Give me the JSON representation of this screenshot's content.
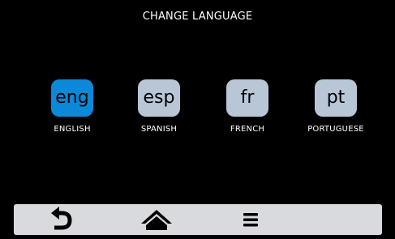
{
  "header": {
    "title": "CHANGE LANGUAGE"
  },
  "languages": [
    {
      "code": "eng",
      "label": "ENGLISH",
      "selected": true
    },
    {
      "code": "esp",
      "label": "SPANISH",
      "selected": false
    },
    {
      "code": "fr",
      "label": "FRENCH",
      "selected": false
    },
    {
      "code": "pt",
      "label": "PORTUGUESE",
      "selected": false
    }
  ],
  "navbar": {
    "icons": [
      "back-arrow-icon",
      "home-icon",
      "menu-icon"
    ]
  },
  "colors": {
    "selected": "#0b89d8",
    "unselected": "#b8c6d6",
    "navbar": "#d8dadd",
    "background": "#000000"
  }
}
